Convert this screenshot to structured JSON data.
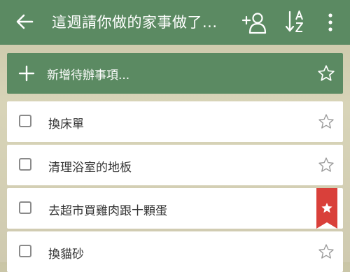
{
  "appbar": {
    "title": "這週請你做的家事做了...",
    "back_icon": "arrow-left-icon",
    "share_icon": "add-person-icon",
    "sort_icon": "sort-az-icon",
    "more_icon": "more-vertical-icon",
    "color": "#5b8a62"
  },
  "add_task": {
    "label": "新增待辦事項...",
    "icon": "plus-icon"
  },
  "tasks": [
    {
      "label": "換床單",
      "done": false,
      "starred": false
    },
    {
      "label": "清理浴室的地板",
      "done": false,
      "starred": false
    },
    {
      "label": "去超市買雞肉跟十顆蛋",
      "done": false,
      "starred": true
    },
    {
      "label": "換貓砂",
      "done": false,
      "starred": false
    }
  ],
  "colors": {
    "star_flag": "#d9403a",
    "outline_star": "#9a9a9a"
  }
}
